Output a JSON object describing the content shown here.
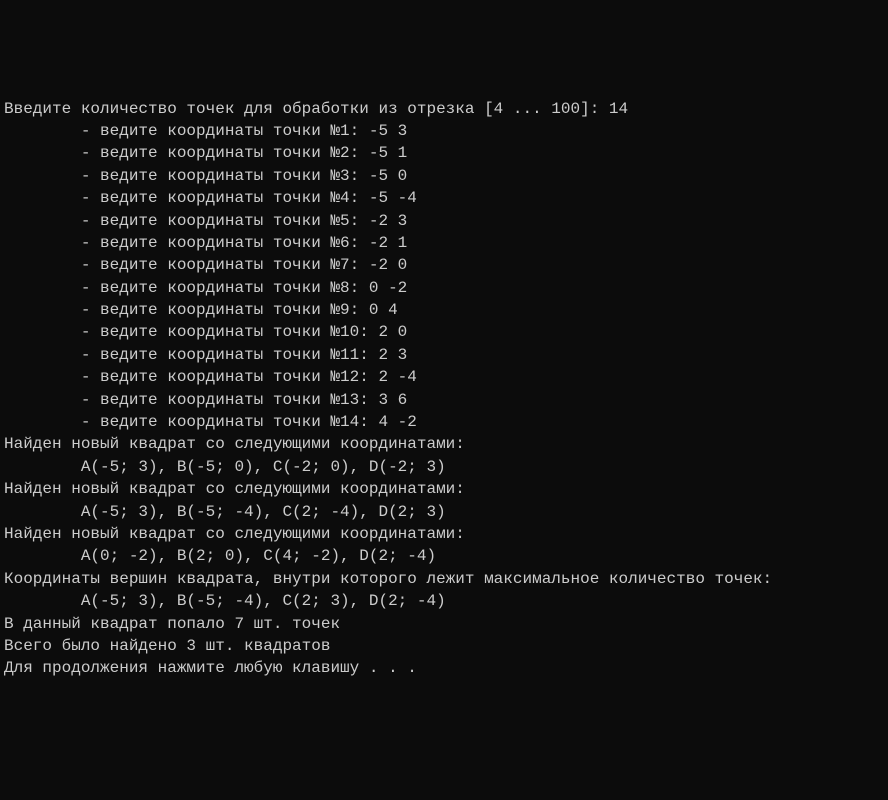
{
  "prompt": {
    "label": "Введите количество точек для обработки из отрезка [4 ... 100]: ",
    "value": "14"
  },
  "points": [
    {
      "prefix": "        - ведите координаты точки №1: ",
      "coords": "-5 3"
    },
    {
      "prefix": "        - ведите координаты точки №2: ",
      "coords": "-5 1"
    },
    {
      "prefix": "        - ведите координаты точки №3: ",
      "coords": "-5 0"
    },
    {
      "prefix": "        - ведите координаты точки №4: ",
      "coords": "-5 -4"
    },
    {
      "prefix": "        - ведите координаты точки №5: ",
      "coords": "-2 3"
    },
    {
      "prefix": "        - ведите координаты точки №6: ",
      "coords": "-2 1"
    },
    {
      "prefix": "        - ведите координаты точки №7: ",
      "coords": "-2 0"
    },
    {
      "prefix": "        - ведите координаты точки №8: ",
      "coords": "0 -2"
    },
    {
      "prefix": "        - ведите координаты точки №9: ",
      "coords": "0 4"
    },
    {
      "prefix": "        - ведите координаты точки №10: ",
      "coords": "2 0"
    },
    {
      "prefix": "        - ведите координаты точки №11: ",
      "coords": "2 3"
    },
    {
      "prefix": "        - ведите координаты точки №12: ",
      "coords": "2 -4"
    },
    {
      "prefix": "        - ведите координаты точки №13: ",
      "coords": "3 6"
    },
    {
      "prefix": "        - ведите координаты точки №14: ",
      "coords": "4 -2"
    }
  ],
  "blank1": "",
  "squares": [
    {
      "header": "Найден новый квадрат со следующими координатами:",
      "coords": "        A(-5; 3), B(-5; 0), C(-2; 0), D(-2; 3)"
    },
    {
      "header": "Найден новый квадрат со следующими координатами:",
      "coords": "        A(-5; 3), B(-5; -4), C(2; -4), D(2; 3)"
    },
    {
      "header": "Найден новый квадрат со следующими координатами:",
      "coords": "        A(0; -2), B(2; 0), C(4; -2), D(2; -4)"
    }
  ],
  "blank2": "",
  "result": {
    "header": "Координаты вершин квадрата, внутри которого лежит максимальное количество точек:",
    "coords": "        A(-5; 3), B(-5; -4), C(2; 3), D(2; -4)",
    "count": "В данный квадрат попало 7 шт. точек"
  },
  "blank3": "",
  "total": "Всего было найдено 3 шт. квадратов",
  "blank4": "",
  "blank5": "",
  "continue": "Для продолжения нажмите любую клавишу . . ."
}
